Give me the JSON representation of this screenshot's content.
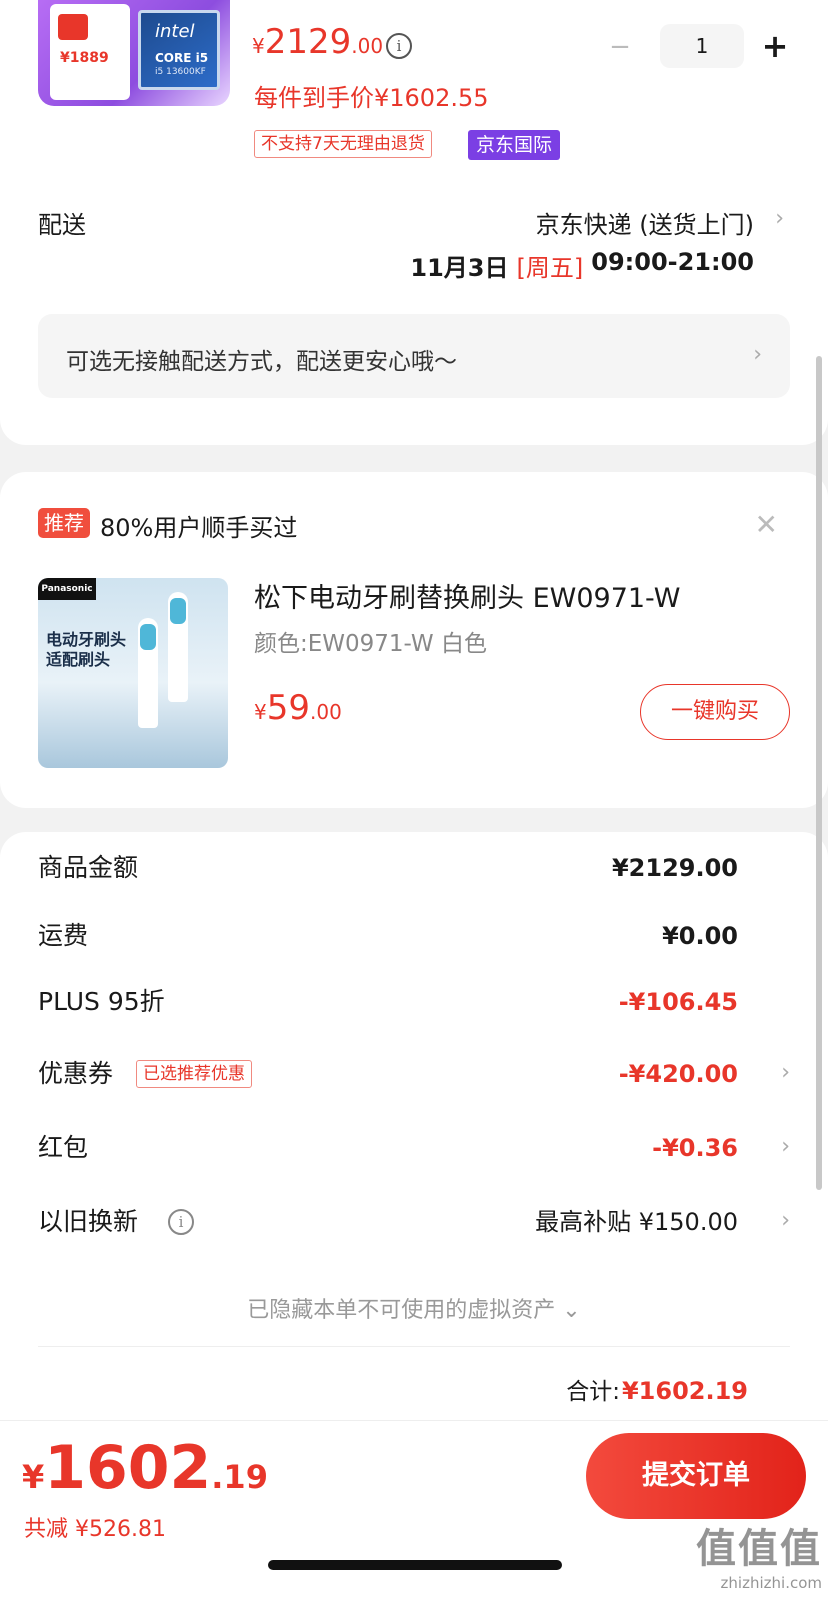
{
  "colors": {
    "accent": "#e8362a",
    "intl_tag": "#7b3fe4",
    "background": "#f2f2f2"
  },
  "product": {
    "thumb": {
      "badge_text": "¥1889",
      "chip_brand": "intel",
      "chip_model": "CORE i5",
      "chip_sku": "i5 13600KF"
    },
    "price_symbol": "¥",
    "price_int": "2129",
    "price_dec": ".00",
    "price_info_icon": "info-icon",
    "quantity": "1",
    "minus_label": "−",
    "plus_label": "+",
    "price_each": "每件到手价¥1602.55",
    "tag_no_return": "不支持7天无理由退货",
    "tag_intl": "京东国际"
  },
  "shipping": {
    "label": "配送",
    "method": "京东快递 (送货上门)",
    "date": "11月3日",
    "weekday": "[周五]",
    "time_window": "09:00-21:00",
    "contactless_text": "可选无接触配送方式，配送更安心哦～"
  },
  "recommendation": {
    "tag": "推荐",
    "title": "80%用户顺手买过",
    "close_icon": "close-icon",
    "thumb": {
      "brand": "Panasonic",
      "headline_line1": "电动牙刷头",
      "headline_line2": "适配刷头"
    },
    "name": "松下电动牙刷替换刷头 EW0971-W",
    "variant": "颜色:EW0971-W 白色",
    "price_symbol": "¥",
    "price_int": "59",
    "price_dec": ".00",
    "buy_button": "一键购买"
  },
  "summary": {
    "rows": [
      {
        "label": "商品金额",
        "value": "¥2129.00"
      },
      {
        "label": "运费",
        "value": "¥0.00"
      },
      {
        "label": "PLUS 95折",
        "value": "-¥106.45"
      },
      {
        "label": "优惠券",
        "tag": "已选推荐优惠",
        "value": "-¥420.00"
      },
      {
        "label": "红包",
        "value": "-¥0.36"
      },
      {
        "label": "以旧换新",
        "value": "最高补贴 ¥150.00"
      }
    ],
    "hidden_note": "已隐藏本单不可使用的虚拟资产 ⌄",
    "total_label": "合计:",
    "total_value": "¥1602.19"
  },
  "bottom": {
    "price_symbol": "¥",
    "price_int": "1602",
    "price_dec": ".19",
    "saved": "共减 ¥526.81",
    "submit": "提交订单"
  },
  "watermark": {
    "big": "值值值",
    "small": "zhizhizhi.com"
  }
}
